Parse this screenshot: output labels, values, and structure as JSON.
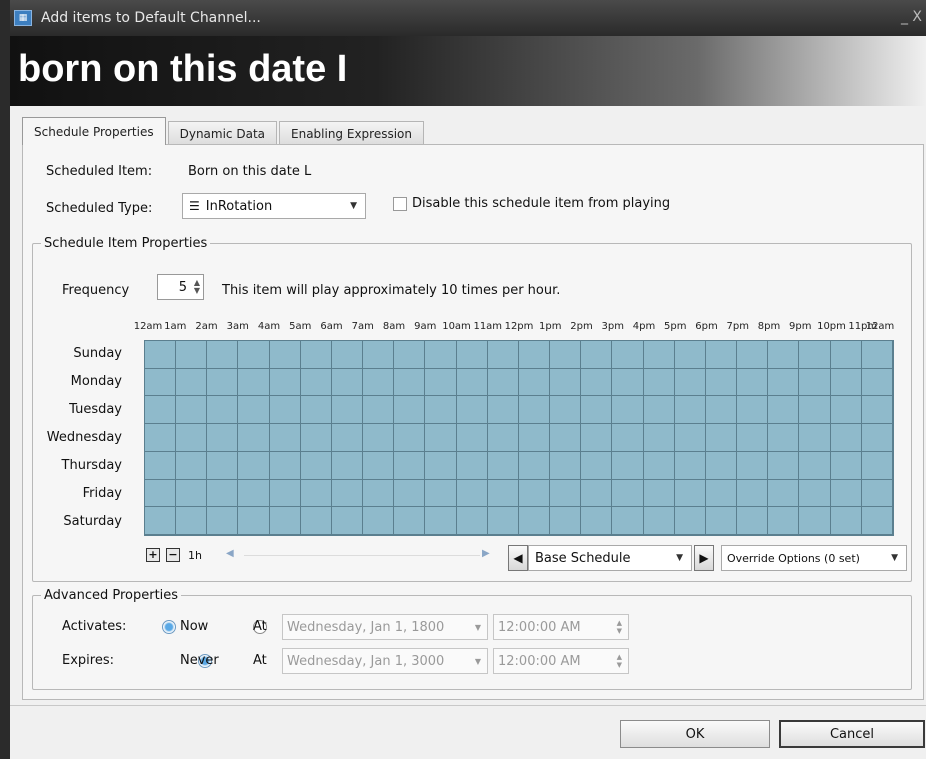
{
  "window": {
    "title": "Add items to Default Channel...",
    "controls": "_ X"
  },
  "banner": {
    "title": "born on this date I"
  },
  "tabs": [
    "Schedule Properties",
    "Dynamic Data",
    "Enabling Expression"
  ],
  "form": {
    "scheduled_item_label": "Scheduled Item:",
    "scheduled_item_value": "Born on this date L",
    "scheduled_type_label": "Scheduled Type:",
    "scheduled_type_value": "InRotation",
    "disable_label": "Disable this schedule item from playing"
  },
  "schedule_props": {
    "legend": "Schedule Item Properties",
    "frequency_label": "Frequency",
    "frequency_value": "5",
    "frequency_info": "This item will play approximately 10 times per hour.",
    "hours": [
      "12am",
      "1am",
      "2am",
      "3am",
      "4am",
      "5am",
      "6am",
      "7am",
      "8am",
      "9am",
      "10am",
      "11am",
      "12pm",
      "1pm",
      "2pm",
      "3pm",
      "4pm",
      "5pm",
      "6pm",
      "7pm",
      "8pm",
      "9pm",
      "10pm",
      "11pm",
      "12am"
    ],
    "days": [
      "Sunday",
      "Monday",
      "Tuesday",
      "Wednesday",
      "Thursday",
      "Friday",
      "Saturday"
    ],
    "zoom_label": "1h",
    "schedule_select": "Base Schedule",
    "override_label": "Override Options (0 set)"
  },
  "advanced": {
    "legend": "Advanced Properties",
    "activates_label": "Activates:",
    "expires_label": "Expires:",
    "now_label": "Now",
    "never_label": "Never",
    "at_label": "At",
    "activate_date": "Wednesday, Jan 1, 1800",
    "activate_time": "12:00:00 AM",
    "expire_date": "Wednesday, Jan 1, 3000",
    "expire_time": "12:00:00 AM"
  },
  "buttons": {
    "ok": "OK",
    "cancel": "Cancel"
  },
  "colors": {
    "grid_fill": "#8fbacb",
    "radio_selected": "#5aa9e6"
  }
}
